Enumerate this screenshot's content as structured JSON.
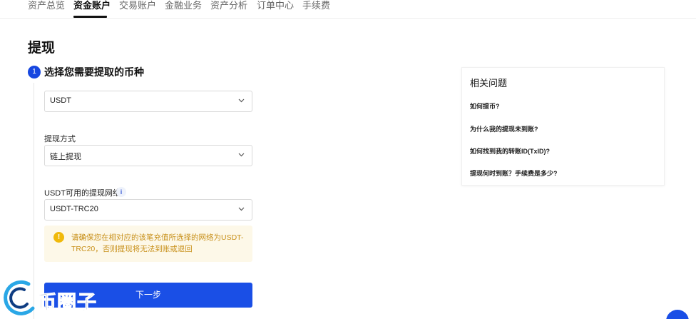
{
  "nav": {
    "tabs": [
      {
        "label": "资产总览"
      },
      {
        "label": "资金账户"
      },
      {
        "label": "交易账户"
      },
      {
        "label": "金融业务"
      },
      {
        "label": "资产分析"
      },
      {
        "label": "订单中心"
      },
      {
        "label": "手续费"
      }
    ],
    "active_index": 1
  },
  "page_title": "提现",
  "step": {
    "number": "1",
    "title": "选择您需要提取的币种"
  },
  "coin_select": {
    "value": "USDT"
  },
  "method": {
    "label": "提现方式",
    "value": "链上提现"
  },
  "network": {
    "label": "USDT可用的提现网络",
    "info": "i",
    "value": "USDT-TRC20"
  },
  "warning": {
    "icon": "!",
    "text": "请确保您在相对应的该笔充值所选择的网络为USDT-TRC20，否则提现将无法到账或退回"
  },
  "next_button": "下一步",
  "faq": {
    "title": "相关问题",
    "items": [
      "如何提币?",
      "为什么我的提现未到账?",
      "如何找到我的转账ID(TxID)?",
      "提现何时到账？手续费是多少?"
    ]
  },
  "watermark": {
    "text": "币圈子"
  },
  "colors": {
    "primary": "#1a4fe6",
    "warning_bg": "#fdf8e8",
    "warning_text": "#c8901a",
    "warning_icon": "#f0b90b"
  },
  "icons": {
    "step": "step-number-badge",
    "dropdown": "chevron-down-icon",
    "info": "info-icon",
    "warning": "warning-icon",
    "chat": "chat-icon"
  }
}
